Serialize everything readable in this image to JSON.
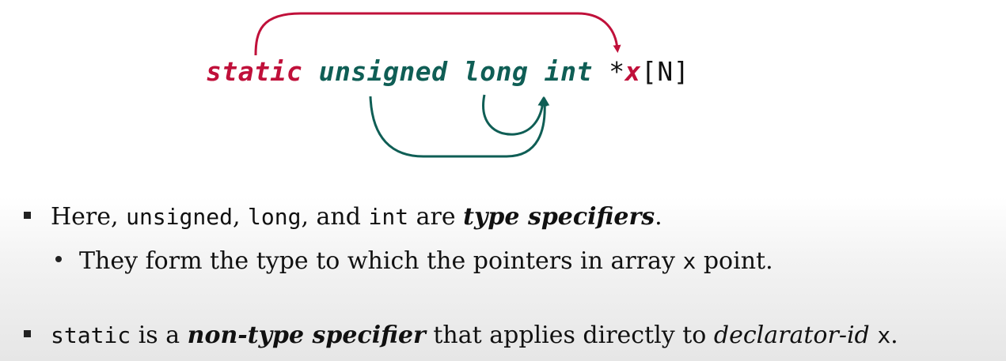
{
  "code": {
    "kw_static": "static",
    "kw_unsigned": "unsigned",
    "kw_long": "long",
    "kw_int": "int",
    "star": "*",
    "var": "x",
    "bracket": "[N]"
  },
  "bullet1": {
    "t1": "Here, ",
    "c1": "unsigned",
    "t2": ", ",
    "c2": "long",
    "t3": ", and ",
    "c3": "int",
    "t4": " are ",
    "em": "type specifiers",
    "t5": "."
  },
  "sub1": {
    "t1": "They form the type to which the pointers in array ",
    "c1": "x",
    "t2": " point."
  },
  "bullet2": {
    "c1": "static",
    "t1": " is a ",
    "em": "non-type specifier",
    "t2": " that applies directly to ",
    "it": "declarator-id",
    "t3": " ",
    "c2": "x",
    "t4": "."
  },
  "colors": {
    "red": "#c0103a",
    "green": "#0f5e55"
  }
}
